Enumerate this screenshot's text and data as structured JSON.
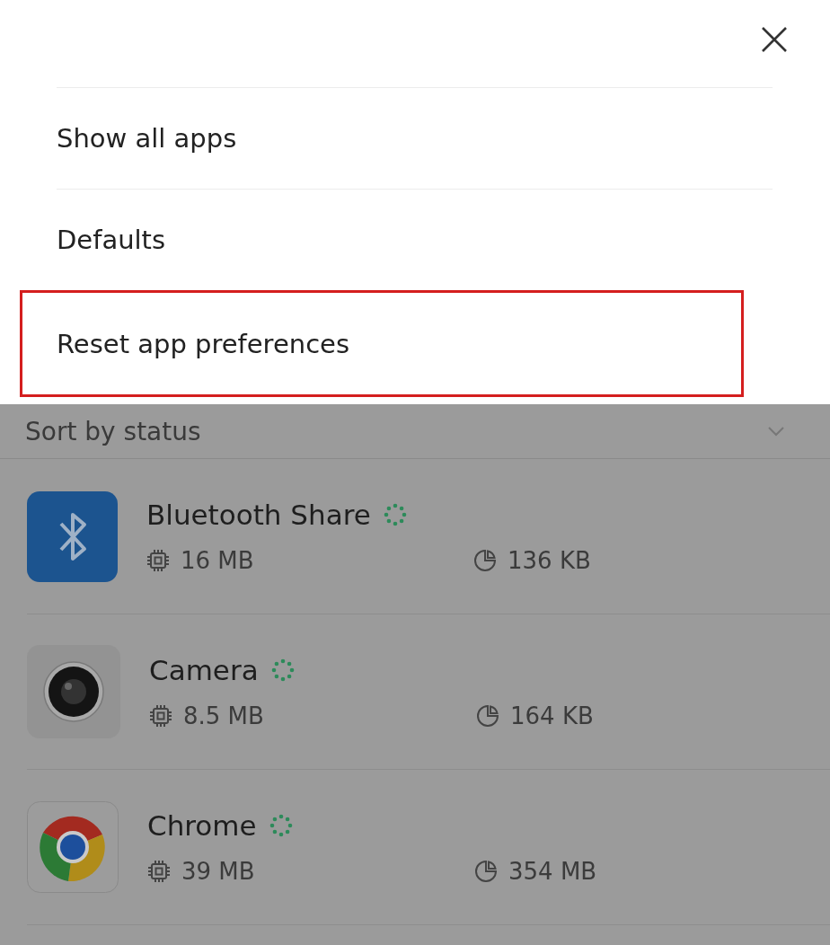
{
  "menu": {
    "items": [
      {
        "label": "Show all apps",
        "selected": false
      },
      {
        "label": "Defaults",
        "selected": false
      },
      {
        "label": "Reset app preferences",
        "selected": true
      }
    ]
  },
  "sort": {
    "label": "Sort by status"
  },
  "apps": [
    {
      "name": "Bluetooth Share",
      "kind": "bluetooth",
      "memory": "16 MB",
      "storage": "136 KB"
    },
    {
      "name": "Camera",
      "kind": "camera",
      "memory": "8.5 MB",
      "storage": "164 KB"
    },
    {
      "name": "Chrome",
      "kind": "chrome",
      "memory": "39 MB",
      "storage": "354 MB"
    }
  ]
}
